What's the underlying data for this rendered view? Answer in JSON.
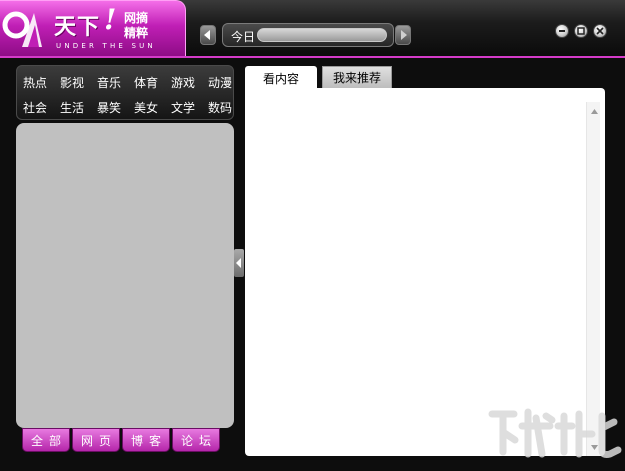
{
  "app": {
    "logo_main": "天下",
    "logo_exclaim": "!",
    "logo_line1": "网摘",
    "logo_line2": "精粹",
    "logo_sub": "UNDER THE SUN"
  },
  "toolbar": {
    "today_label": "今日"
  },
  "categories": {
    "row1": [
      "热点",
      "影视",
      "音乐",
      "体育",
      "游戏",
      "动漫"
    ],
    "row2": [
      "社会",
      "生活",
      "暴笑",
      "美女",
      "文学",
      "数码"
    ]
  },
  "bottom_tabs": [
    "全部",
    "网页",
    "博客",
    "论坛"
  ],
  "content_tabs": {
    "active": "看内容",
    "inactive": "我来推荐"
  },
  "colors": {
    "accent": "#c01fb5",
    "accent_light": "#f46ee8",
    "frame": "#0d0d0d"
  },
  "icons": [
    "logo-mark-icon",
    "arrow-left-icon",
    "arrow-right-icon",
    "minimize-icon",
    "restore-icon",
    "close-icon",
    "collapse-panel-icon",
    "scroll-up-icon",
    "scroll-down-icon",
    "watermark-logo"
  ]
}
